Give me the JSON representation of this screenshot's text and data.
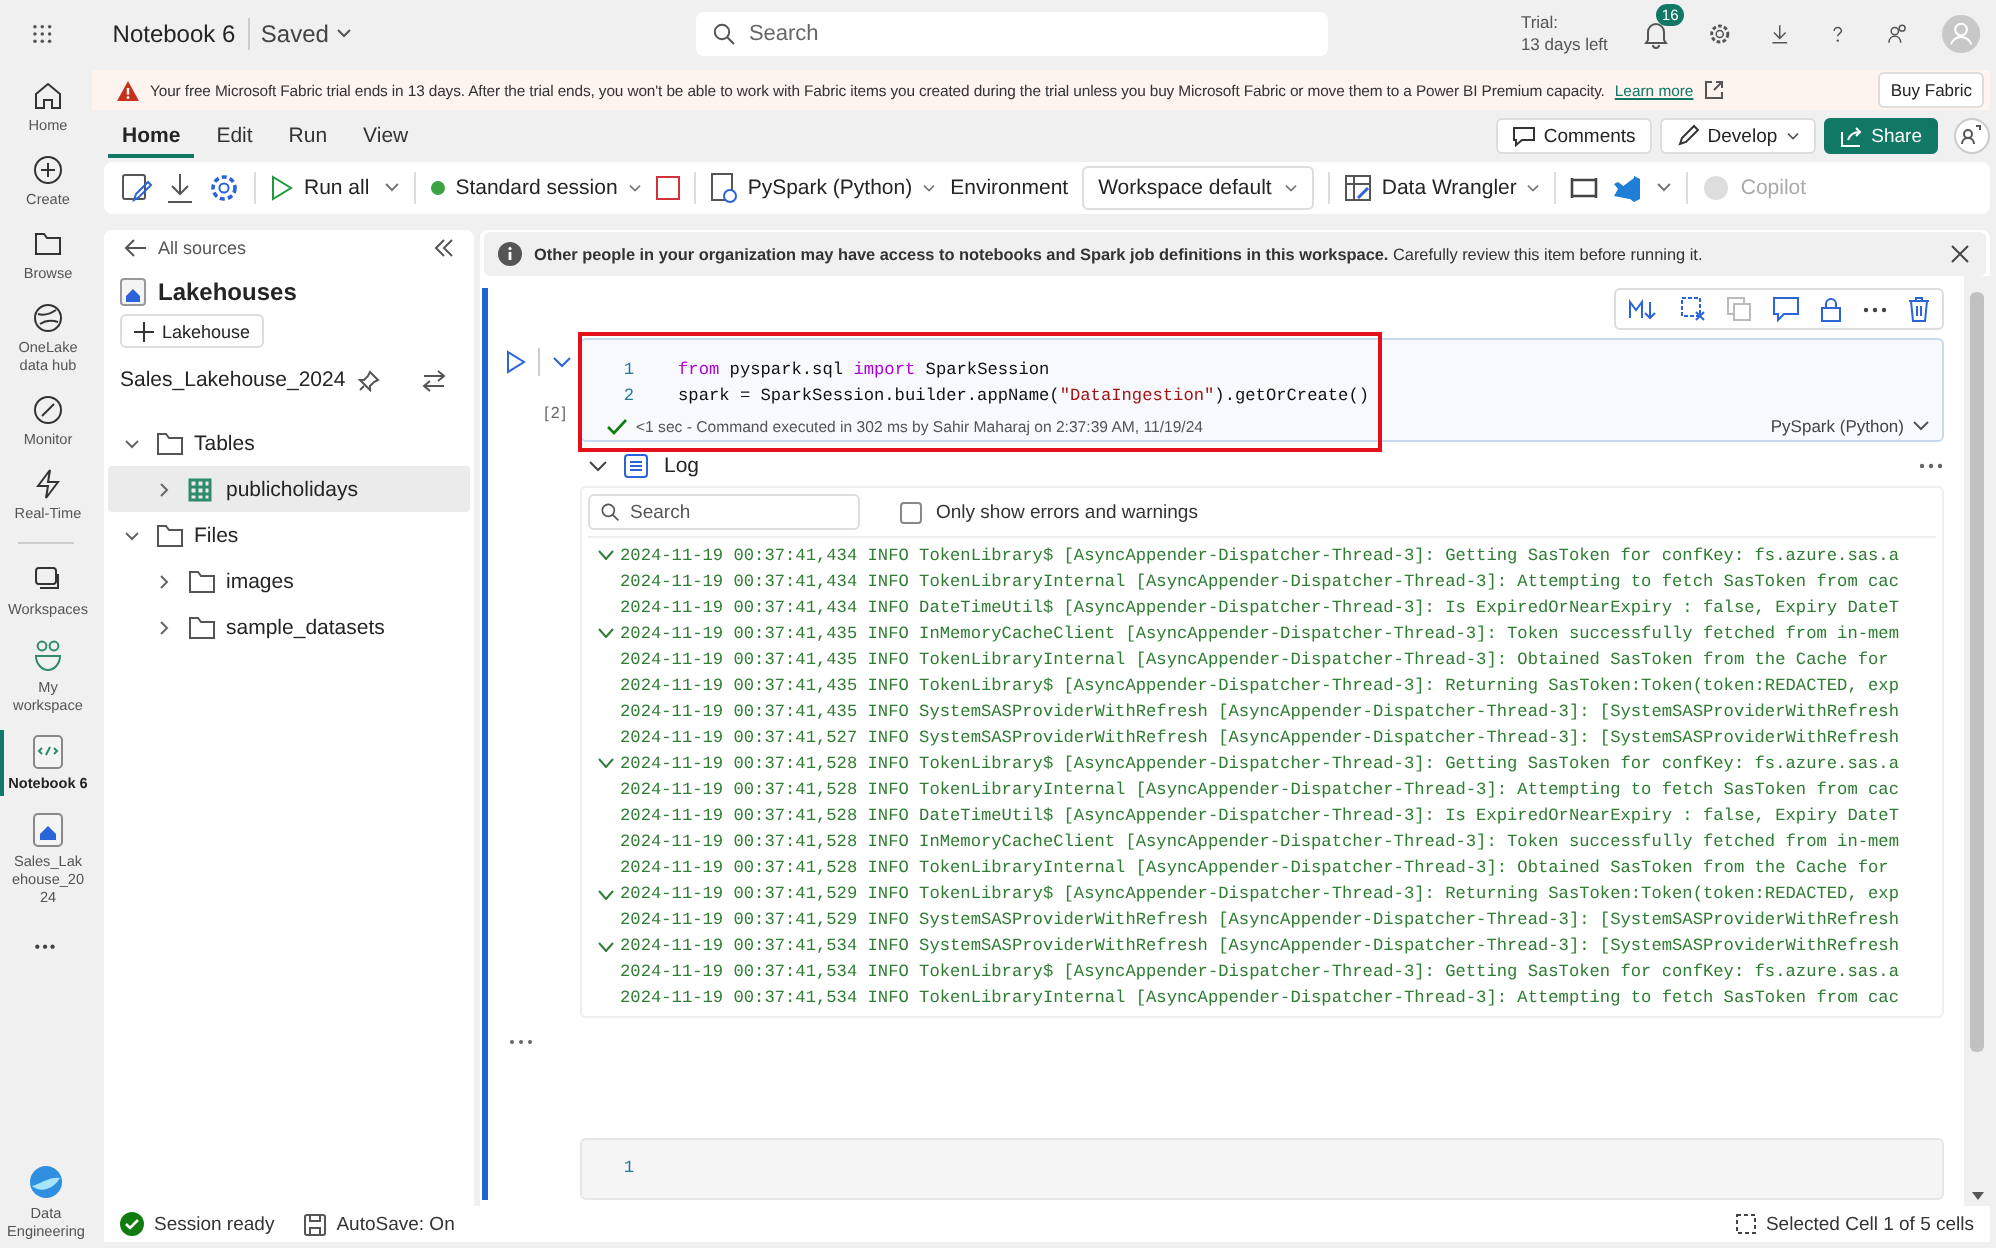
{
  "app_bar": {
    "title": "Notebook 6",
    "save_state": "Saved",
    "search": {
      "placeholder": "Search"
    },
    "trial": {
      "label": "Trial:",
      "days_left": "13 days left"
    },
    "notification_count": "16"
  },
  "rail": [
    {
      "kind": "home",
      "label": "Home",
      "selected": false
    },
    {
      "kind": "create",
      "label": "Create",
      "selected": false
    },
    {
      "kind": "browse",
      "label": "Browse",
      "selected": false
    },
    {
      "kind": "onelake",
      "label": "OneLake data hub",
      "selected": false
    },
    {
      "kind": "monitor",
      "label": "Monitor",
      "selected": false
    },
    {
      "kind": "realtime",
      "label": "Real-Time",
      "selected": false
    },
    {
      "kind": "workspaces",
      "label": "Workspaces",
      "selected": false
    },
    {
      "kind": "myworkspace",
      "label": "My workspace",
      "selected": false
    },
    {
      "kind": "notebook",
      "label": "Notebook 6",
      "selected": true
    },
    {
      "kind": "lakehouse",
      "label": "Sales_Lakehouse_2024",
      "selected": false
    }
  ],
  "rail_more": "•••",
  "rail_footer": "Data Engineering",
  "banner": {
    "message": "Your free Microsoft Fabric trial ends in 13 days. After the trial ends, you won't be able to work with Fabric items you created during the trial unless you buy Microsoft Fabric or move them to a Power BI Premium capacity.",
    "link": "Learn more",
    "button": "Buy Fabric"
  },
  "ribbon_tabs": [
    {
      "label": "Home",
      "selected": true
    },
    {
      "label": "Edit",
      "selected": false
    },
    {
      "label": "Run",
      "selected": false
    },
    {
      "label": "View",
      "selected": false
    }
  ],
  "ribbon_actions": [
    {
      "kind": "comments",
      "label": "Comments"
    },
    {
      "kind": "develop",
      "label": "Develop"
    },
    {
      "kind": "share",
      "label": "Share"
    }
  ],
  "toolbar": {
    "run_all": "Run all",
    "session": "Standard session",
    "language": "PySpark (Python)",
    "environment_label": "Environment",
    "environment": "Workspace default",
    "data_wrangler": "Data Wrangler",
    "copilot": {
      "label": "Copilot",
      "disabled": true
    }
  },
  "explorer": {
    "back": "All sources",
    "title": "Lakehouses",
    "add_button": "Lakehouse",
    "lakehouse": "Sales_Lakehouse_2024",
    "tree": [
      {
        "kind": "folder",
        "label": "Tables",
        "expanded": true,
        "selected": false,
        "children": [
          {
            "kind": "table",
            "label": "publicholidays",
            "expanded": false,
            "selected": true
          }
        ]
      },
      {
        "kind": "folder",
        "label": "Files",
        "expanded": true,
        "selected": false,
        "children": [
          {
            "kind": "folder",
            "label": "images",
            "expanded": false,
            "selected": false
          },
          {
            "kind": "folder",
            "label": "sample_datasets",
            "expanded": false,
            "selected": false
          }
        ]
      }
    ]
  },
  "notice": "**Other people in your organization may have access to notebooks and Spark job definitions in this workspace.** Carefully review this item before running it.",
  "cells": [
    {
      "execution_count": "[2]",
      "highlighted": true,
      "lines": [
        {
          "number": "1",
          "tokens": [
            {
              "kind": "keyword",
              "text": "from"
            },
            {
              "kind": "plain",
              "text": " pyspark.sql "
            },
            {
              "kind": "keyword",
              "text": "import"
            },
            {
              "kind": "plain",
              "text": " SparkSession"
            }
          ]
        },
        {
          "number": "2",
          "tokens": [
            {
              "kind": "plain",
              "text": "spark = SparkSession.builder.appName("
            },
            {
              "kind": "string",
              "text": "\"DataIngestion\""
            },
            {
              "kind": "plain",
              "text": ").getOrCreate()"
            }
          ]
        }
      ],
      "status": "<1 sec - Command executed in 302 ms by Sahir Maharaj on 2:37:39 AM, 11/19/24",
      "language": "PySpark (Python)",
      "log": {
        "title": "Log",
        "search": {
          "placeholder": "Search"
        },
        "errors_only": {
          "label": "Only show errors and warnings",
          "checked": false
        },
        "lines": [
          {
            "expanded": true,
            "text": "2024-11-19 00:37:41,434 INFO TokenLibrary$ [AsyncAppender-Dispatcher-Thread-3]: Getting SasToken for confKey: fs.azure.sas.a"
          },
          {
            "expanded": false,
            "text": "2024-11-19 00:37:41,434 INFO TokenLibraryInternal [AsyncAppender-Dispatcher-Thread-3]: Attempting to fetch SasToken from cac"
          },
          {
            "expanded": false,
            "text": "2024-11-19 00:37:41,434 INFO DateTimeUtil$ [AsyncAppender-Dispatcher-Thread-3]: Is ExpiredOrNearExpiry : false, Expiry DateT"
          },
          {
            "expanded": true,
            "text": "2024-11-19 00:37:41,435 INFO InMemoryCacheClient [AsyncAppender-Dispatcher-Thread-3]: Token successfully fetched from in-mem"
          },
          {
            "expanded": false,
            "text": "2024-11-19 00:37:41,435 INFO TokenLibraryInternal [AsyncAppender-Dispatcher-Thread-3]: Obtained SasToken from the Cache for"
          },
          {
            "expanded": false,
            "text": "2024-11-19 00:37:41,435 INFO TokenLibrary$ [AsyncAppender-Dispatcher-Thread-3]: Returning SasToken:Token(token:REDACTED, exp"
          },
          {
            "expanded": false,
            "text": "2024-11-19 00:37:41,435 INFO SystemSASProviderWithRefresh [AsyncAppender-Dispatcher-Thread-3]: [SystemSASProviderWithRefresh"
          },
          {
            "expanded": false,
            "text": "2024-11-19 00:37:41,527 INFO SystemSASProviderWithRefresh [AsyncAppender-Dispatcher-Thread-3]: [SystemSASProviderWithRefresh"
          },
          {
            "expanded": true,
            "text": "2024-11-19 00:37:41,528 INFO TokenLibrary$ [AsyncAppender-Dispatcher-Thread-3]: Getting SasToken for confKey: fs.azure.sas.a"
          },
          {
            "expanded": false,
            "text": "2024-11-19 00:37:41,528 INFO TokenLibraryInternal [AsyncAppender-Dispatcher-Thread-3]: Attempting to fetch SasToken from cac"
          },
          {
            "expanded": false,
            "text": "2024-11-19 00:37:41,528 INFO DateTimeUtil$ [AsyncAppender-Dispatcher-Thread-3]: Is ExpiredOrNearExpiry : false, Expiry DateT"
          },
          {
            "expanded": false,
            "text": "2024-11-19 00:37:41,528 INFO InMemoryCacheClient [AsyncAppender-Dispatcher-Thread-3]: Token successfully fetched from in-mem"
          },
          {
            "expanded": false,
            "text": "2024-11-19 00:37:41,528 INFO TokenLibraryInternal [AsyncAppender-Dispatcher-Thread-3]: Obtained SasToken from the Cache for"
          },
          {
            "expanded": true,
            "text": "2024-11-19 00:37:41,529 INFO TokenLibrary$ [AsyncAppender-Dispatcher-Thread-3]: Returning SasToken:Token(token:REDACTED, exp"
          },
          {
            "expanded": false,
            "text": "2024-11-19 00:37:41,529 INFO SystemSASProviderWithRefresh [AsyncAppender-Dispatcher-Thread-3]: [SystemSASProviderWithRefresh"
          },
          {
            "expanded": true,
            "text": "2024-11-19 00:37:41,534 INFO SystemSASProviderWithRefresh [AsyncAppender-Dispatcher-Thread-3]: [SystemSASProviderWithRefresh"
          },
          {
            "expanded": false,
            "text": "2024-11-19 00:37:41,534 INFO TokenLibrary$ [AsyncAppender-Dispatcher-Thread-3]: Getting SasToken for confKey: fs.azure.sas.a"
          },
          {
            "expanded": false,
            "text": "2024-11-19 00:37:41,534 INFO TokenLibraryInternal [AsyncAppender-Dispatcher-Thread-3]: Attempting to fetch SasToken from cac"
          }
        ]
      }
    },
    {
      "highlighted": false,
      "lines": [
        {
          "number": "1"
        }
      ]
    }
  ],
  "status_bar": {
    "session": "Session ready",
    "autosave": "AutoSave: On",
    "selection": "Selected Cell 1 of 5 cells"
  }
}
